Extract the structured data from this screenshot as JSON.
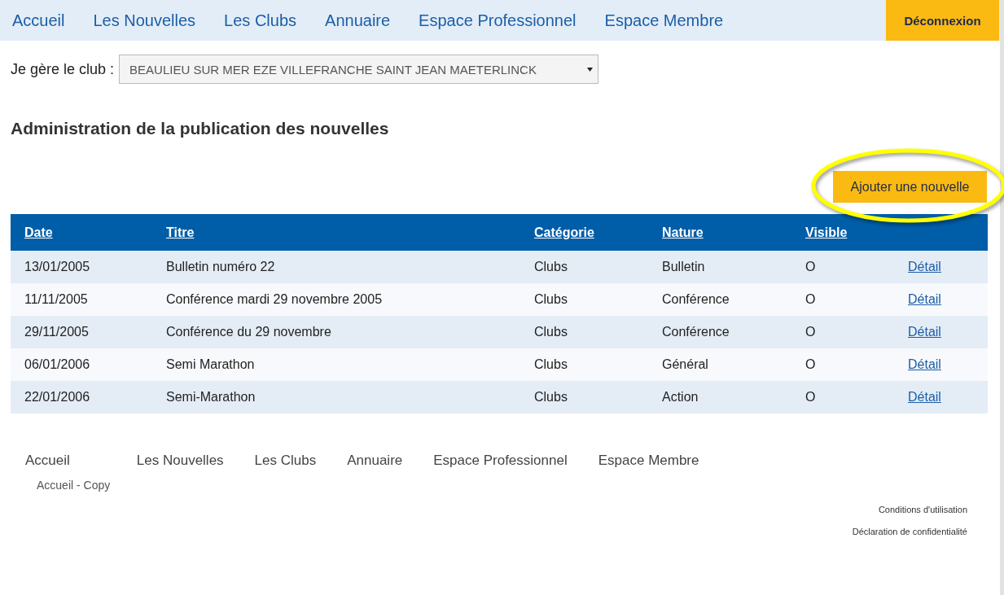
{
  "nav": {
    "links": [
      "Accueil",
      "Les Nouvelles",
      "Les Clubs",
      "Annuaire",
      "Espace Professionnel",
      "Espace Membre"
    ],
    "logout": "Déconnexion"
  },
  "club_picker": {
    "label": "Je gère le club :",
    "value": "BEAULIEU SUR MER EZE VILLEFRANCHE SAINT JEAN MAETERLINCK"
  },
  "heading": "Administration de la publication des nouvelles",
  "add_button": {
    "label": "Ajouter une nouvelle",
    "highlighted": true
  },
  "table": {
    "columns": [
      "Date",
      "Titre",
      "Catégorie",
      "Nature",
      "Visible"
    ],
    "rows": [
      {
        "date": "13/01/2005",
        "title": "Bulletin numéro 22",
        "category": "Clubs",
        "nature": "Bulletin",
        "visible": "O",
        "link": "Détail"
      },
      {
        "date": "11/11/2005",
        "title": "Conférence mardi 29 novembre 2005",
        "category": "Clubs",
        "nature": "Conférence",
        "visible": "O",
        "link": "Détail"
      },
      {
        "date": "29/11/2005",
        "title": "Conférence du 29 novembre",
        "category": "Clubs",
        "nature": "Conférence",
        "visible": "O",
        "link": "Détail"
      },
      {
        "date": "06/01/2006",
        "title": "Semi Marathon",
        "category": "Clubs",
        "nature": "Général",
        "visible": "O",
        "link": "Détail"
      },
      {
        "date": "22/01/2006",
        "title": "Semi-Marathon",
        "category": "Clubs",
        "nature": "Action",
        "visible": "O",
        "link": "Détail"
      }
    ]
  },
  "footer": {
    "links": [
      "Accueil",
      "Les Nouvelles",
      "Les Clubs",
      "Annuaire",
      "Espace Professionnel",
      "Espace Membre"
    ],
    "sublink": "Accueil - Copy",
    "legal": [
      "Conditions d'utilisation",
      "Déclaration de confidentialité"
    ]
  }
}
